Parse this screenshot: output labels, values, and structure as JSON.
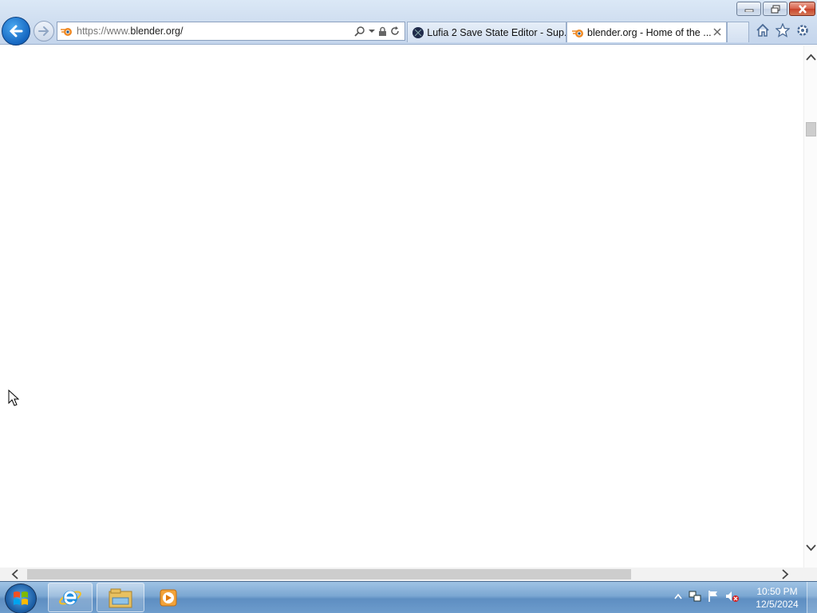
{
  "window": {
    "caption_buttons": [
      "minimize",
      "restore",
      "close"
    ]
  },
  "navigation": {
    "back_icon": "back-arrow-icon",
    "forward_icon": "forward-arrow-icon"
  },
  "address_bar": {
    "url_prefix": "https://www.",
    "url_domain": "blender.org/",
    "site_icon": "blender-logo-icon",
    "tools": [
      "search-icon",
      "dropdown-icon",
      "lock-icon",
      "refresh-icon"
    ]
  },
  "tabs": [
    {
      "title": "Lufia 2 Save State Editor - Sup...",
      "icon": "site-favicon-icon",
      "active": false
    },
    {
      "title": "blender.org - Home of the ...",
      "icon": "blender-logo-icon",
      "active": true
    }
  ],
  "toolbar_right": [
    "home-icon",
    "favorites-star-icon",
    "settings-gear-icon"
  ],
  "taskbar": {
    "pinned": [
      "internet-explorer-icon",
      "file-explorer-icon",
      "media-player-icon"
    ],
    "tray": [
      "show-hidden-icons-icon",
      "network-icon",
      "action-center-flag-icon",
      "volume-muted-icon"
    ],
    "time": "10:50 PM",
    "date": "12/5/2024"
  },
  "colors": {
    "chrome": "#cddcef",
    "taskbar": "#7ba7d2",
    "accent": "#1566c0"
  }
}
